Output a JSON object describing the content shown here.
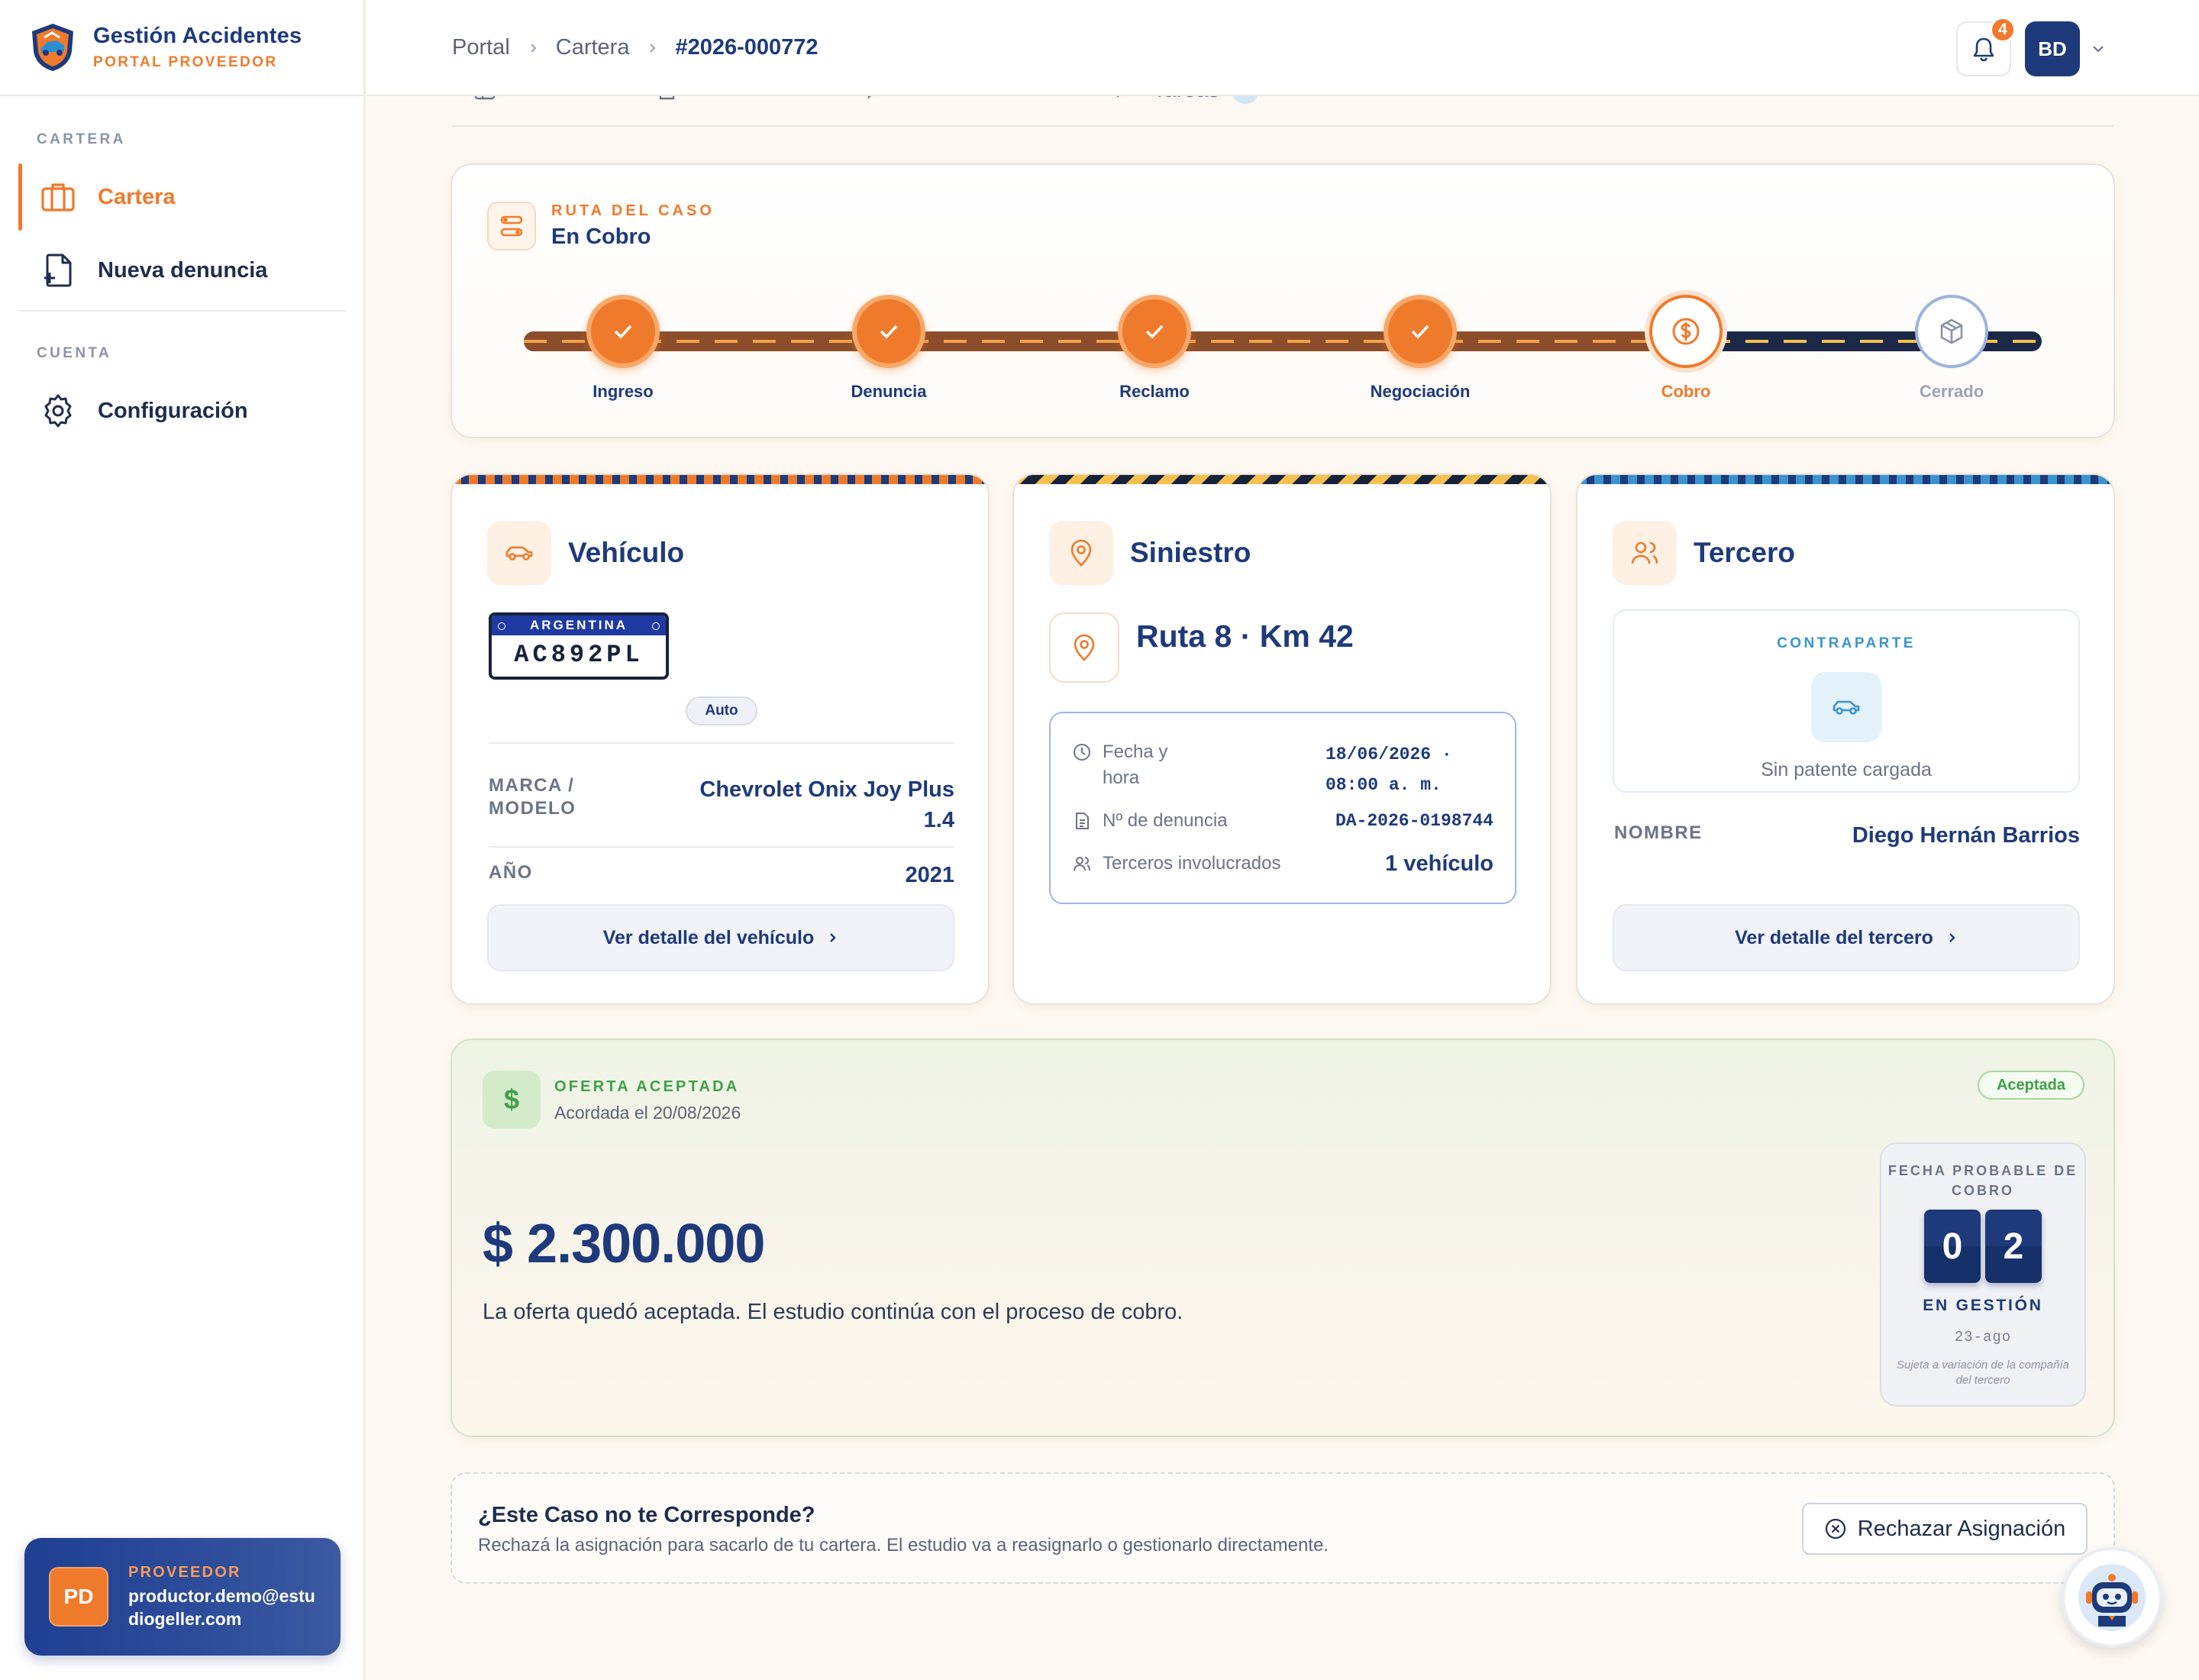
{
  "brand": {
    "title": "Gestión Accidentes",
    "subtitle": "PORTAL PROVEEDOR",
    "accent": "#f07a2b",
    "navy": "#1e3a7a"
  },
  "sidebar": {
    "section_cartera": "CARTERA",
    "section_cuenta": "CUENTA",
    "items": [
      {
        "label": "Cartera",
        "icon": "briefcase-icon",
        "active": true
      },
      {
        "label": "Nueva denuncia",
        "icon": "file-plus-icon",
        "active": false
      },
      {
        "label": "Configuración",
        "icon": "gear-icon",
        "active": false
      }
    ],
    "user": {
      "initials": "PD",
      "role": "PROVEEDOR",
      "email": "productor.demo@estudiogeller.com"
    }
  },
  "header": {
    "breadcrumb": [
      "Portal",
      "Cartera",
      "#2026-000772"
    ],
    "notifications": "4",
    "user_initials": "BD"
  },
  "tabs": [
    "Resumen",
    "Documentos",
    "Actualizaciones",
    "Tareas"
  ],
  "route": {
    "label": "RUTA DEL CASO",
    "value": "En Cobro",
    "steps": [
      {
        "label": "Ingreso",
        "state": "done"
      },
      {
        "label": "Denuncia",
        "state": "done"
      },
      {
        "label": "Reclamo",
        "state": "done"
      },
      {
        "label": "Negociación",
        "state": "done"
      },
      {
        "label": "Cobro",
        "state": "current"
      },
      {
        "label": "Cerrado",
        "state": "pending"
      }
    ]
  },
  "vehiculo": {
    "title": "Vehículo",
    "plate_country": "ARGENTINA",
    "plate": "AC892PL",
    "type": "Auto",
    "brand_label": "MARCA / MODELO",
    "brand_value": "Chevrolet Onix Joy Plus 1.4",
    "year_label": "AÑO",
    "year_value": "2021",
    "button": "Ver detalle del vehículo"
  },
  "siniestro": {
    "title": "Siniestro",
    "location": "Ruta 8 · Km 42",
    "date_label": "Fecha y hora",
    "date_value": "18/06/2026 · 08:00 a. m.",
    "denuncia_label": "Nº de denuncia",
    "denuncia_value": "DA-2026-0198744",
    "terceros_label": "Terceros involucrados",
    "terceros_value": "1 vehículo"
  },
  "tercero": {
    "title": "Tercero",
    "contraparte": "CONTRAPARTE",
    "no_plate": "Sin patente cargada",
    "name_label": "NOMBRE",
    "name_value": "Diego Hernán Barrios",
    "button": "Ver detalle del tercero"
  },
  "oferta": {
    "label": "OFERTA ACEPTADA",
    "date": "Acordada el 20/08/2026",
    "status": "Aceptada",
    "amount": "$ 2.300.000",
    "message": "La oferta quedó aceptada. El estudio continúa con el proceso de cobro.",
    "cobro_label": "FECHA PROBABLE DE COBRO",
    "digits": [
      "0",
      "2"
    ],
    "gestion": "EN GESTIÓN",
    "cobro_date": "23-ago",
    "note": "Sujeta a variación de la compañía del tercero"
  },
  "reject": {
    "question": "¿Este Caso no te Corresponde?",
    "desc": "Rechazá la asignación para sacarlo de tu cartera. El estudio va a reasignarlo o gestionarlo directamente.",
    "button": "Rechazar Asignación"
  }
}
